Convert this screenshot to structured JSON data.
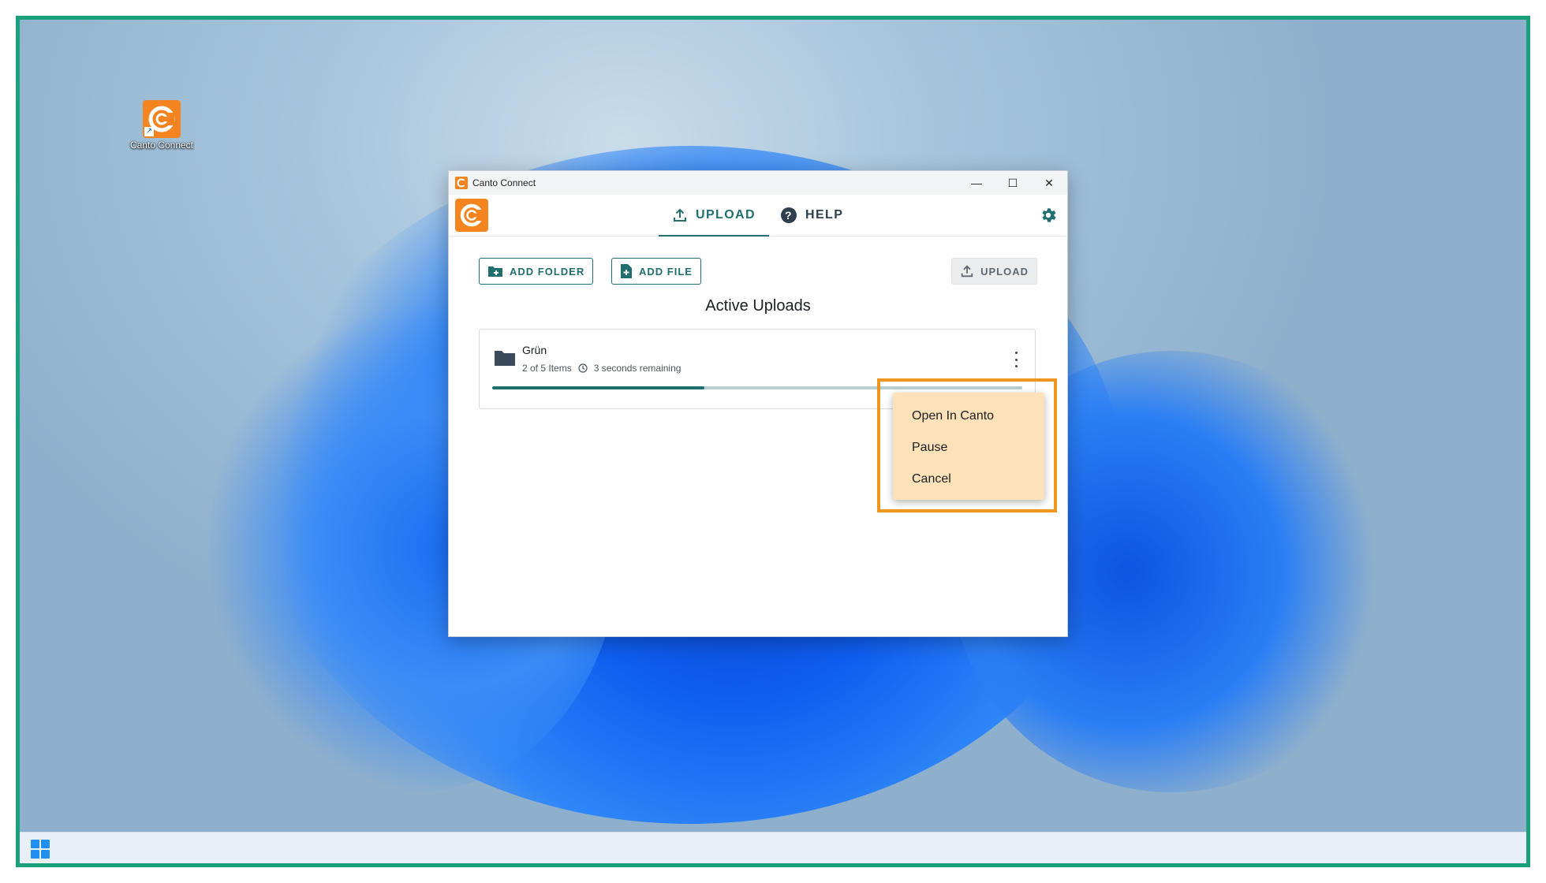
{
  "desktop": {
    "icon_label": "Canto Connect"
  },
  "window": {
    "title": "Canto Connect",
    "controls": {
      "minimize": "—",
      "maximize": "☐",
      "close": "✕"
    }
  },
  "nav": {
    "tabs": [
      {
        "label": "UPLOAD",
        "icon": "upload-icon",
        "selected": true
      },
      {
        "label": "HELP",
        "icon": "help-circle-icon",
        "selected": false
      }
    ]
  },
  "toolbar": {
    "add_folder": "ADD FOLDER",
    "add_file": "ADD FILE",
    "upload": "UPLOAD"
  },
  "section": {
    "title": "Active Uploads"
  },
  "upload_item": {
    "name": "Grün",
    "items": "2 of 5 Items",
    "remaining": "3 seconds remaining",
    "progress": 0.4
  },
  "context_menu": {
    "items": [
      "Open In Canto",
      "Pause",
      "Cancel"
    ]
  },
  "colors": {
    "accent": "#1f6f6e",
    "brand_orange": "#f4841f",
    "highlight": "#f0961f",
    "frame": "#1aa07a"
  }
}
